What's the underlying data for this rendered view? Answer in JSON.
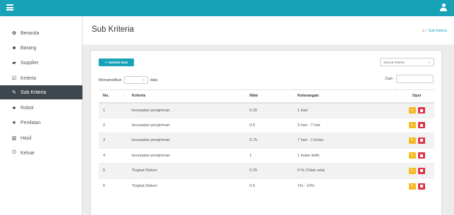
{
  "colors": {
    "topbar": "#17a2b8",
    "accent": "#17a2b8",
    "sidebar_active": "#3f474e",
    "edit": "#f5b921",
    "delete": "#dc3545"
  },
  "sidebar": {
    "items": [
      {
        "label": "Beranda",
        "icon": "tachometer-icon"
      },
      {
        "label": "Barang",
        "icon": "square-icon"
      },
      {
        "label": "Supplier",
        "icon": "truck-icon"
      },
      {
        "label": "Kriteria",
        "icon": "edit-box-icon"
      },
      {
        "label": "Sub Kriteria",
        "icon": "edit-icon",
        "active": true
      },
      {
        "label": "Robot",
        "icon": "sitemap-icon"
      },
      {
        "label": "Penilaian",
        "icon": "star-icon"
      },
      {
        "label": "Hasil",
        "icon": "bar-chart-icon"
      },
      {
        "label": "Keluar",
        "icon": "power-icon"
      }
    ]
  },
  "header": {
    "title": "Sub Kriteria",
    "breadcrumb": "Sub Kriteria"
  },
  "toolbar": {
    "add_label": "Tambah Data",
    "filter_value": "Semua Kriteria"
  },
  "table_controls": {
    "show_prefix": "Menampilkan",
    "show_suffix": "data",
    "search_label": "Cari:"
  },
  "table": {
    "headers": [
      "No.",
      "Kriteria",
      "Nilai",
      "Keterangan",
      "Opsi"
    ],
    "rows": [
      [
        "1",
        "kecepatan pengiriman",
        "0.25",
        "1 Hari"
      ],
      [
        "2",
        "kecepatan pengiriman",
        "0.5",
        "3 hari - 7 hari"
      ],
      [
        "3",
        "kecepatan pengiriman",
        "0.75",
        "7 hari - 1 bulan"
      ],
      [
        "4",
        "kecepatan pengiriman",
        "1",
        "1 bulan lebih"
      ],
      [
        "5",
        "Tingkat Diskon",
        "0.25",
        "0 % (Tidak ada)"
      ],
      [
        "6",
        "Tingkat Diskon",
        "0.5",
        "1% - 10%"
      ]
    ]
  }
}
